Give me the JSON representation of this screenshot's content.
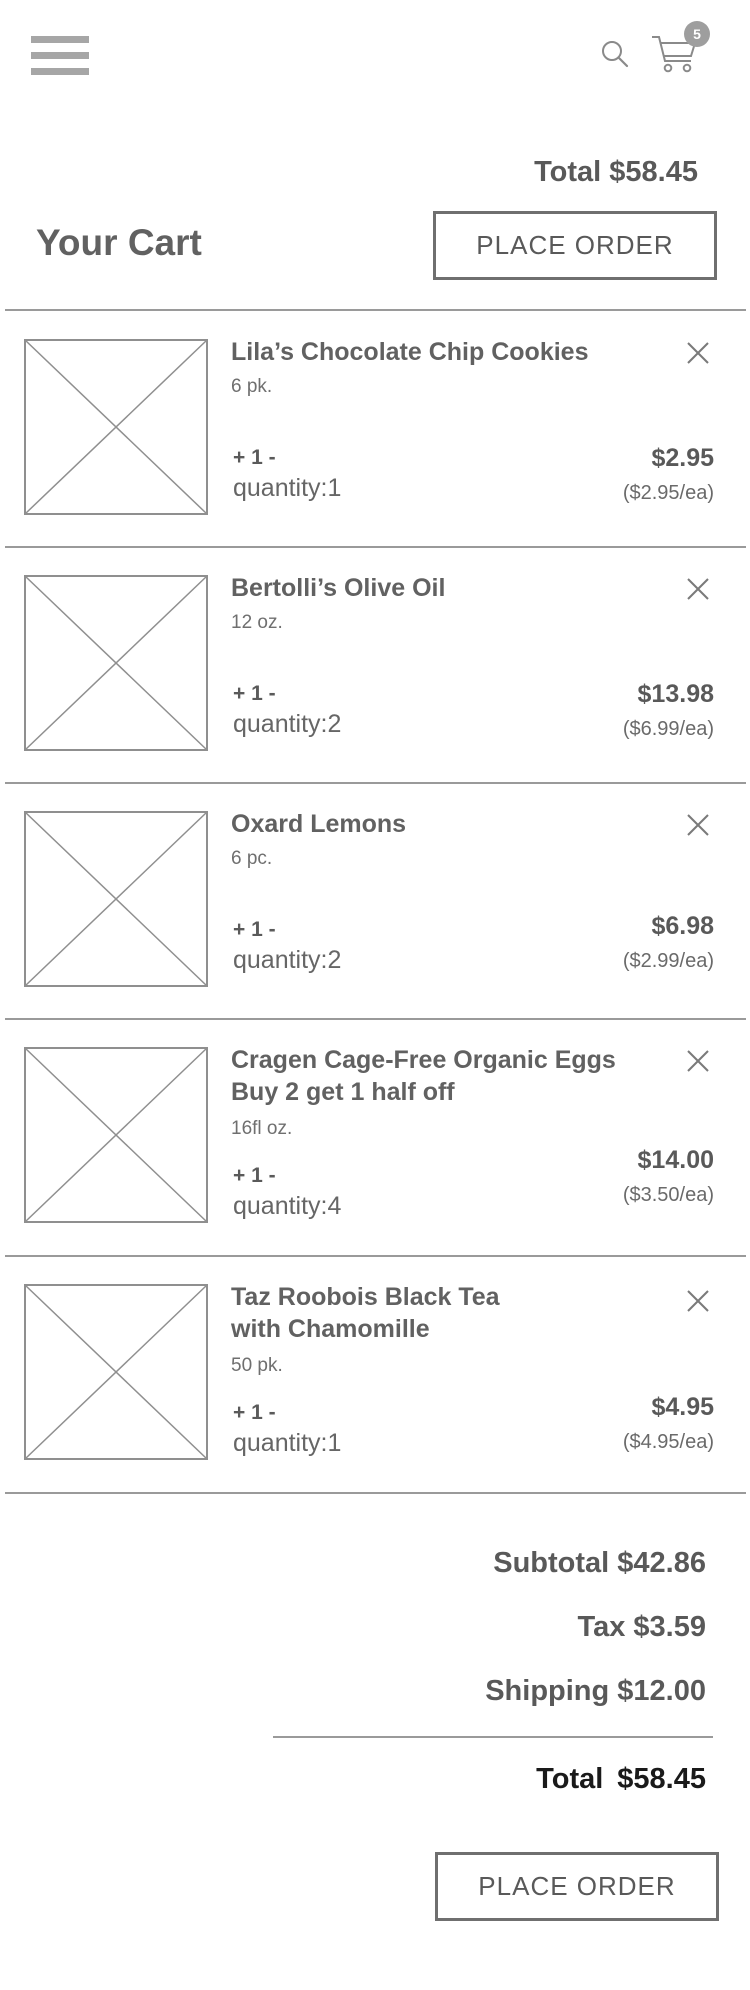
{
  "header": {
    "cart_count": "5"
  },
  "summary_top": {
    "total_label": "Total $58.45"
  },
  "page_title": "Your Cart",
  "place_order_label": "PLACE ORDER",
  "items": [
    {
      "name": "Lila’s Chocolate Chip Cookies",
      "size": "6 pk.",
      "stepper": "+ 1 -",
      "quantity": "quantity:1",
      "price": "$2.95",
      "unit_price": "($2.95/ea)"
    },
    {
      "name": "Bertolli’s Olive Oil",
      "size": "12 oz.",
      "stepper": "+ 1 -",
      "quantity": "quantity:2",
      "price": "$13.98",
      "unit_price": "($6.99/ea)"
    },
    {
      "name": "Oxard Lemons",
      "size": "6 pc.",
      "stepper": "+ 1 -",
      "quantity": "quantity:2",
      "price": "$6.98",
      "unit_price": "($2.99/ea)"
    },
    {
      "name": "Cragen Cage-Free Organic Eggs",
      "name_line2": "Buy 2 get 1 half off",
      "size": "16fl oz.",
      "stepper": "+ 1 -",
      "quantity": "quantity:4",
      "price": "$14.00",
      "unit_price": "($3.50/ea)"
    },
    {
      "name": "Taz Roobois Black Tea",
      "name_line2": "with Chamomille",
      "size": "50 pk.",
      "stepper": "+ 1 -",
      "quantity": "quantity:1",
      "price": "$4.95",
      "unit_price": "($4.95/ea)"
    }
  ],
  "summary": {
    "subtotal": "Subtotal $42.86",
    "tax": "Tax $3.59",
    "shipping": "Shipping $12.00",
    "total_label": "Total",
    "total_value": "$58.45"
  }
}
